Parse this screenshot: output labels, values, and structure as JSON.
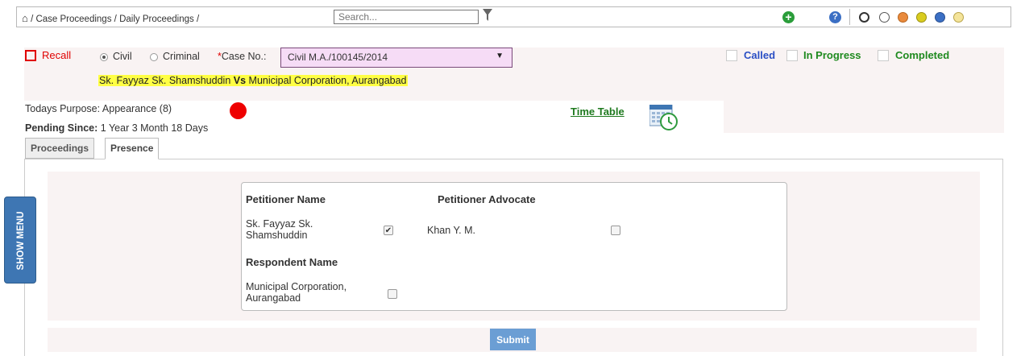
{
  "breadcrumb": {
    "home_icon": "⌂",
    "separator": "/",
    "items": [
      "Case Proceedings",
      "Daily Proceedings"
    ]
  },
  "search": {
    "placeholder": "Search..."
  },
  "toolbar": {
    "add_icon": "+",
    "help_icon": "?"
  },
  "theme_colors": [
    "#ffffff",
    "#ffffff",
    "#e98a3c",
    "#d9cc1f",
    "#3b6fc4",
    "#f4e49a"
  ],
  "case": {
    "recall_label": "Recall",
    "type_options": [
      "Civil",
      "Criminal"
    ],
    "selected_type": "Civil",
    "required_mark": "*",
    "case_no_label": "Case No.:",
    "case_no_value": "Civil M.A./100145/2014",
    "petitioner": "Sk. Fayyaz Sk. Shamshuddin",
    "versus": "Vs",
    "respondent": "Municipal Corporation, Aurangabad"
  },
  "status": {
    "called": "Called",
    "in_progress": "In Progress",
    "completed": "Completed"
  },
  "purpose": {
    "label": "Todays Purpose:",
    "value": "Appearance (8)",
    "pending_label": "Pending Since:",
    "pending_value": "1 Year 3 Month 18 Days",
    "time_table": "Time Table"
  },
  "tabs": [
    "Proceedings",
    "Presence"
  ],
  "active_tab": "Presence",
  "presence": {
    "petitioner_name_header": "Petitioner Name",
    "petitioner_advocate_header": "Petitioner Advocate",
    "respondent_name_header": "Respondent Name",
    "petitioner_line1": "Sk. Fayyaz Sk.",
    "petitioner_line2": "Shamshuddin",
    "petitioner_checked": true,
    "advocate": "Khan Y. M.",
    "advocate_checked": false,
    "respondent_line1": "Municipal Corporation,",
    "respondent_line2": "Aurangabad",
    "respondent_checked": false
  },
  "submit_label": "Submit",
  "show_menu_label": "SHOW MENU"
}
